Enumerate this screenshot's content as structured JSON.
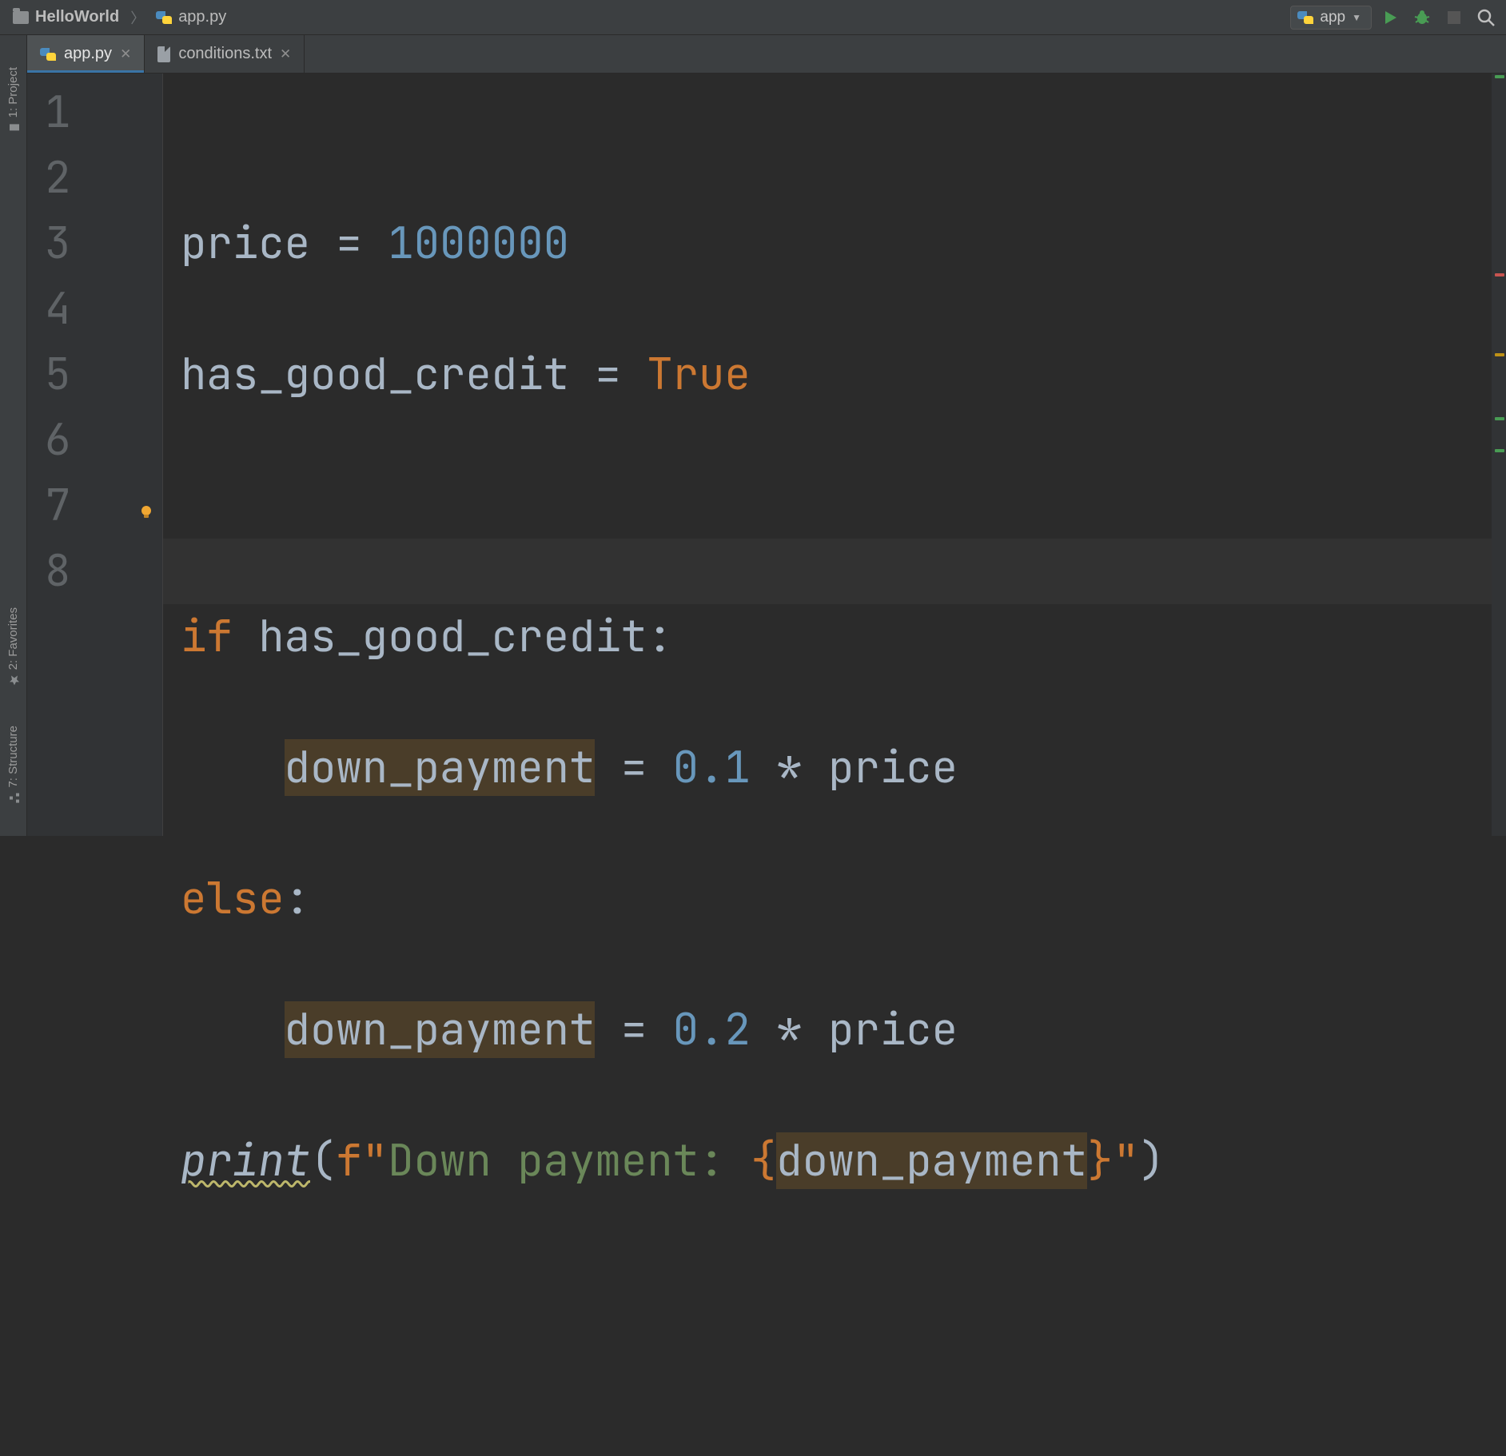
{
  "breadcrumb": {
    "project": "HelloWorld",
    "file": "app.py"
  },
  "run_config": {
    "name": "app"
  },
  "tabs": [
    {
      "name": "app.py",
      "type": "python",
      "active": true
    },
    {
      "name": "conditions.txt",
      "type": "text",
      "active": false
    }
  ],
  "tool_windows": {
    "project": "1: Project",
    "favorites": "2: Favorites",
    "structure": "7: Structure"
  },
  "gutter": {
    "lines": [
      "1",
      "2",
      "3",
      "4",
      "5",
      "6",
      "7",
      "8"
    ],
    "bulb_line": 7
  },
  "code": {
    "l1": {
      "a": "price ",
      "op": "= ",
      "num": "1000000"
    },
    "l2": {
      "a": "has_good_credit ",
      "op": "= ",
      "bool": "True"
    },
    "l3": "",
    "l4": {
      "kw": "if ",
      "rest": "has_good_credit:"
    },
    "l5": {
      "indent": "    ",
      "lhs": "down_payment",
      "mid": " = ",
      "num": "0.1",
      "tail": " * price"
    },
    "l6": {
      "kw": "else",
      "colon": ":"
    },
    "l7": {
      "indent": "    ",
      "lhs": "down_payment",
      "mid": " = ",
      "num": "0.2",
      "tail": " * price"
    },
    "l8": {
      "fn": "print",
      "open": "(",
      "pfx": "f\"",
      "str": "Down payment: ",
      "lb": "{",
      "var": "down_payment",
      "rb": "}",
      "sfx": "\"",
      "close": ")"
    }
  },
  "colors": {
    "run": "#499c54",
    "debug": "#499c54",
    "stop_disabled": "#555",
    "search": "#bfbfbf"
  }
}
